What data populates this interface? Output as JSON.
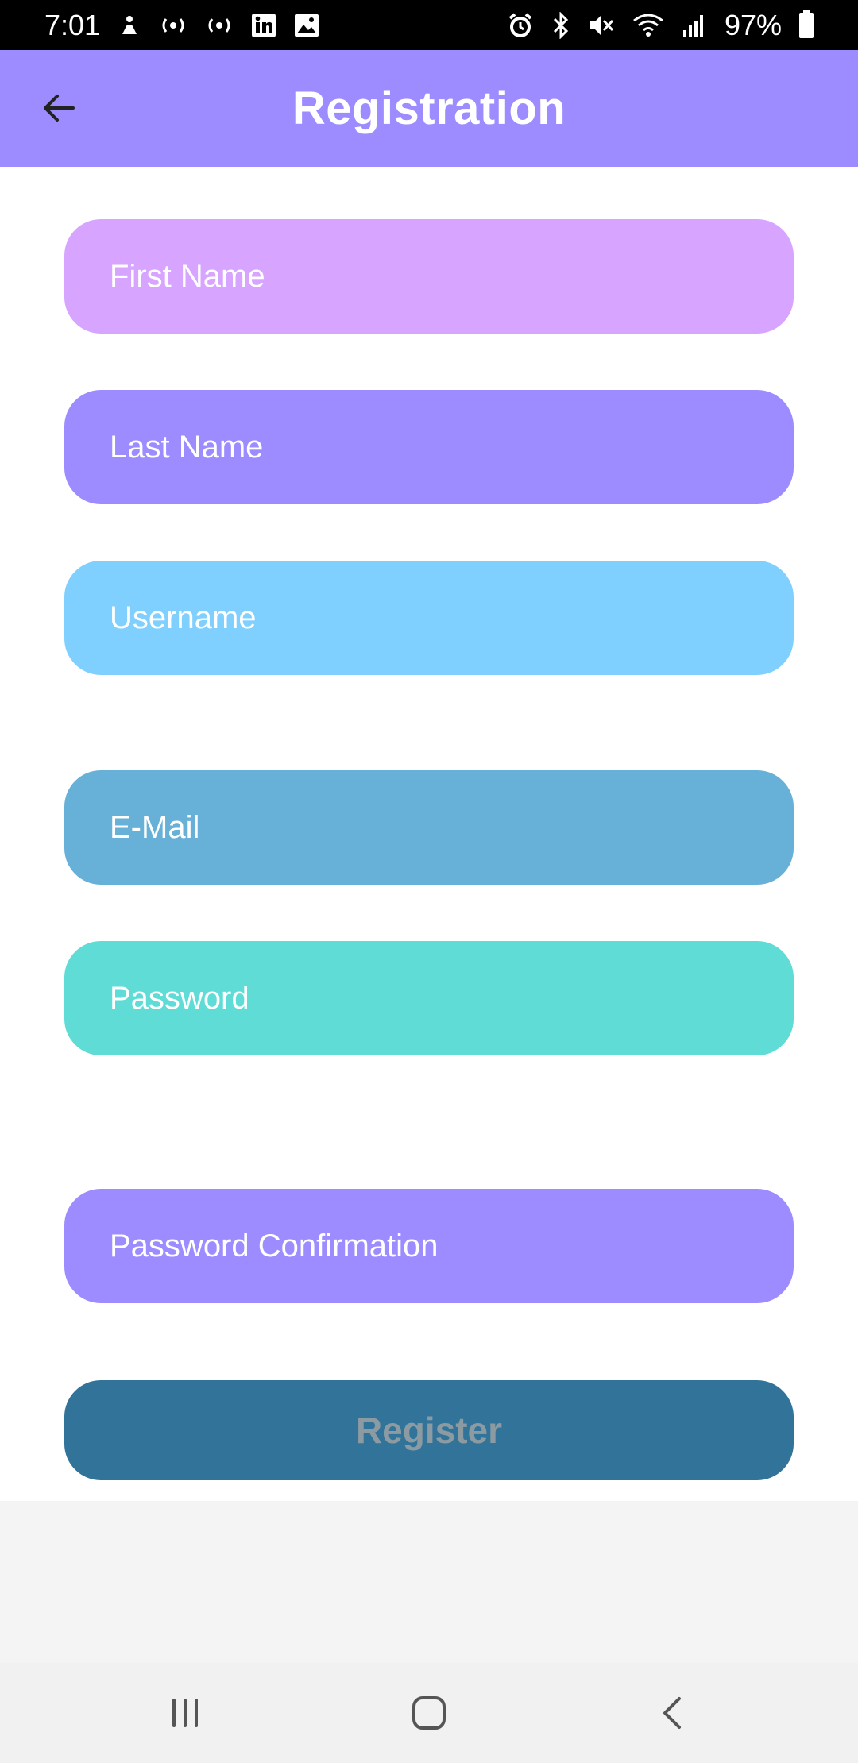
{
  "status_bar": {
    "time": "7:01",
    "battery": "97%",
    "left_icons": [
      "notification-icon",
      "cast-icon",
      "cast-icon",
      "linkedin-icon",
      "image-icon"
    ],
    "right_icons": [
      "alarm-icon",
      "bluetooth-icon",
      "mute-icon",
      "wifi-icon",
      "signal-icon",
      "battery-icon"
    ]
  },
  "app_bar": {
    "title": "Registration",
    "color": "#9d8cff"
  },
  "form": {
    "fields": [
      {
        "placeholder": "First Name",
        "value": "",
        "color": "#d7a4ff"
      },
      {
        "placeholder": "Last Name",
        "value": "",
        "color": "#9d8cff"
      },
      {
        "placeholder": "Username",
        "value": "",
        "color": "#80d0ff"
      },
      {
        "placeholder": "E-Mail",
        "value": "",
        "color": "#67b0d8"
      },
      {
        "placeholder": "Password",
        "value": "",
        "color": "#5edcd5"
      },
      {
        "placeholder": "Password Confirmation",
        "value": "",
        "color": "#9d8cff"
      }
    ],
    "register_label": "Register",
    "register_color": "#32739a"
  },
  "nav_bar": {
    "buttons": [
      "recent-apps-icon",
      "home-icon",
      "back-icon"
    ]
  }
}
